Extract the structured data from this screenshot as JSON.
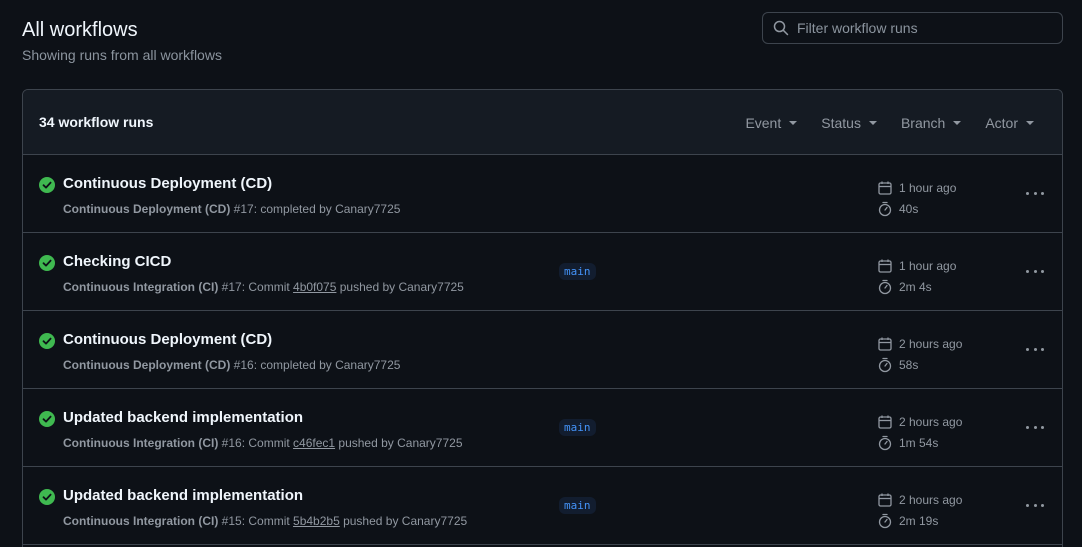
{
  "header": {
    "title": "All workflows",
    "subtitle": "Showing runs from all workflows"
  },
  "search": {
    "placeholder": "Filter workflow runs",
    "icon": "search-icon"
  },
  "list": {
    "count_label": "34 workflow runs",
    "filters": [
      "Event",
      "Status",
      "Branch",
      "Actor"
    ]
  },
  "colors": {
    "success": "#3fb950",
    "accent": "#4493f8"
  },
  "runs": [
    {
      "title": "Continuous Deployment (CD)",
      "workflow": "Continuous Deployment (CD)",
      "number": "#17",
      "middle": ": completed by Canary7725",
      "sha": "",
      "suffix": "",
      "branch": "",
      "time": "1 hour ago",
      "duration": "40s"
    },
    {
      "title": "Checking CICD",
      "workflow": "Continuous Integration (CI)",
      "number": "#17",
      "middle": ": Commit ",
      "sha": "4b0f075",
      "suffix": " pushed by Canary7725",
      "branch": "main",
      "time": "1 hour ago",
      "duration": "2m 4s"
    },
    {
      "title": "Continuous Deployment (CD)",
      "workflow": "Continuous Deployment (CD)",
      "number": "#16",
      "middle": ": completed by Canary7725",
      "sha": "",
      "suffix": "",
      "branch": "",
      "time": "2 hours ago",
      "duration": "58s"
    },
    {
      "title": "Updated backend implementation",
      "workflow": "Continuous Integration (CI)",
      "number": "#16",
      "middle": ": Commit ",
      "sha": "c46fec1",
      "suffix": " pushed by Canary7725",
      "branch": "main",
      "time": "2 hours ago",
      "duration": "1m 54s"
    },
    {
      "title": "Updated backend implementation",
      "workflow": "Continuous Integration (CI)",
      "number": "#15",
      "middle": ": Commit ",
      "sha": "5b4b2b5",
      "suffix": " pushed by Canary7725",
      "branch": "main",
      "time": "2 hours ago",
      "duration": "2m 19s"
    }
  ]
}
